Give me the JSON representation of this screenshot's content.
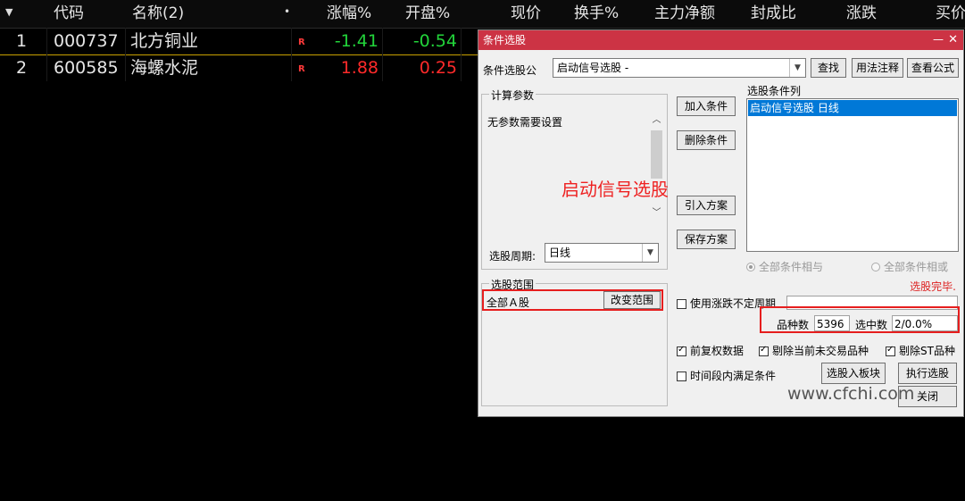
{
  "grid": {
    "headers": {
      "code": "代码",
      "name": "名称(2)",
      "change_pct": "涨幅%",
      "open": "开盘%",
      "price": "现价",
      "turnover": "换手%",
      "main_net": "主力净额",
      "seal_ratio": "封成比",
      "up_down": "涨跌",
      "bid": "买价"
    },
    "rows": [
      {
        "index": "1",
        "code": "000737",
        "name": "北方铜业",
        "badge": "R",
        "change_pct": "-1.41",
        "open": "-0.54"
      },
      {
        "index": "2",
        "code": "600585",
        "name": "海螺水泥",
        "badge": "R",
        "change_pct": "1.88",
        "open": "0.25"
      }
    ]
  },
  "dialog": {
    "title": "条件选股",
    "formula_label": "条件选股公",
    "formula_value": "启动信号选股  -",
    "buttons": {
      "find": "查找",
      "usage": "用法注释",
      "view_formula": "查看公式",
      "add_condition": "加入条件",
      "delete_condition": "删除条件",
      "import_plan": "引入方案",
      "save_plan": "保存方案",
      "change_range": "改变范围",
      "to_block": "选股入板块",
      "execute": "执行选股",
      "close": "关闭"
    },
    "params_group_title": "计算参数",
    "params_text": "无参数需要设置",
    "overlay_label": "启动信号选股",
    "period_label": "选股周期:",
    "period_value": "日线",
    "conditions_title": "选股条件列",
    "conditions": [
      "启动信号选股  日线"
    ],
    "radio_and": "全部条件相与",
    "radio_or": "全部条件相或",
    "status": "选股完毕.",
    "range_group_title": "选股范围",
    "range_value": "全部Ａ股",
    "use_range_checkbox": "使用涨跌不定周期",
    "count_label": "品种数",
    "count_value": "5396",
    "selected_label": "选中数",
    "selected_value": "2/0.0%",
    "check_adjust": "前复权数据",
    "check_remove_untraded": "剔除当前未交易品种",
    "check_remove_st": "剔除ST品种",
    "check_time_period": "时间段内满足条件"
  },
  "watermark": "www.cfchi.com",
  "colors": {
    "up": "#ff2a2a",
    "down": "#22d43a",
    "title_bar": "#cc3344",
    "highlight_box": "#e61e1e"
  }
}
